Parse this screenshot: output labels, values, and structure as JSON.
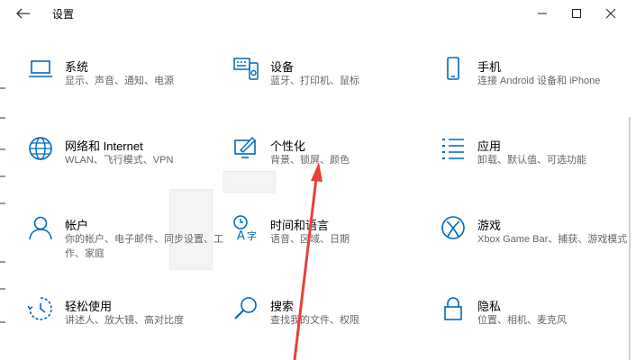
{
  "window": {
    "title": "设置"
  },
  "tiles": [
    {
      "title": "系统",
      "subtitle": "显示、声音、通知、电源",
      "icon": "laptop-icon"
    },
    {
      "title": "设备",
      "subtitle": "蓝牙、打印机、鼠标",
      "icon": "keyboard-speaker-icon"
    },
    {
      "title": "手机",
      "subtitle": "连接 Android 设备和 iPhone",
      "icon": "phone-icon"
    },
    {
      "title": "网络和 Internet",
      "subtitle": "WLAN、飞行模式、VPN",
      "icon": "globe-icon"
    },
    {
      "title": "个性化",
      "subtitle": "背景、锁屏、颜色",
      "icon": "paint-monitor-icon"
    },
    {
      "title": "应用",
      "subtitle": "卸载、默认值、可选功能",
      "icon": "apps-list-icon"
    },
    {
      "title": "帐户",
      "subtitle": "你的帐户、电子邮件、同步设置、工作、家庭",
      "icon": "person-icon"
    },
    {
      "title": "时间和语言",
      "subtitle": "语音、区域、日期",
      "icon": "time-language-icon"
    },
    {
      "title": "游戏",
      "subtitle": "Xbox Game Bar、捕获、游戏模式",
      "icon": "xbox-icon"
    },
    {
      "title": "轻松使用",
      "subtitle": "讲述人、放大镜、高对比度",
      "icon": "ease-of-access-icon"
    },
    {
      "title": "搜索",
      "subtitle": "查找我的文件、权限",
      "icon": "search-icon"
    },
    {
      "title": "隐私",
      "subtitle": "位置、相机、麦克风",
      "icon": "lock-icon"
    }
  ],
  "colors": {
    "accent": "#0067c0",
    "arrow": "#e8403a"
  }
}
